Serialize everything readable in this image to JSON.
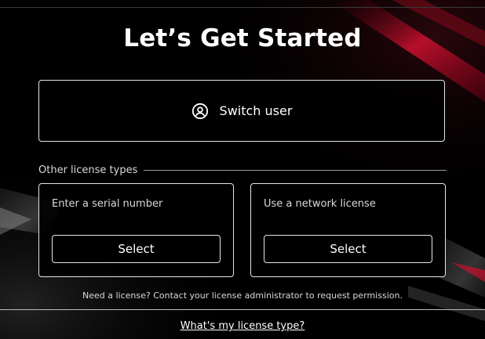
{
  "title": "Let’s Get Started",
  "switch_user": {
    "label": "Switch user",
    "icon": "user-circle-icon"
  },
  "other_license_types": "Other license types",
  "cards": [
    {
      "label": "Enter a serial number",
      "button": "Select"
    },
    {
      "label": "Use a network license",
      "button": "Select"
    }
  ],
  "need_license_text": "Need a license? Contact your license administrator to request permission.",
  "license_type_link": "What's my license type?",
  "colors": {
    "background": "#000000",
    "border": "#e6e6e6",
    "accent_red": "#c8102e"
  }
}
